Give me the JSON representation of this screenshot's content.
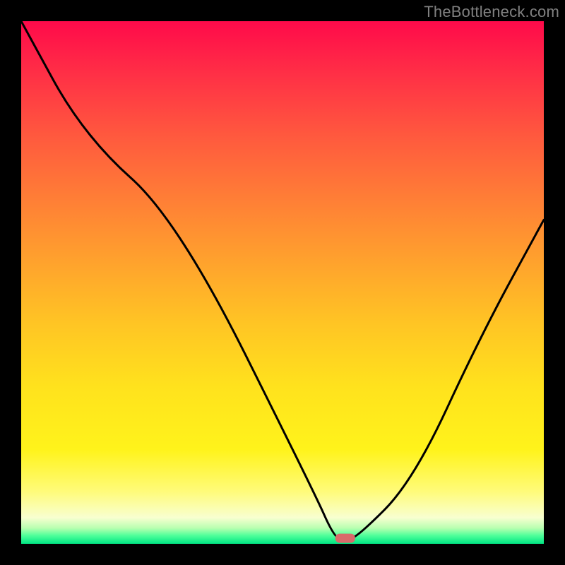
{
  "attribution": "TheBottleneck.com",
  "chart_data": {
    "type": "line",
    "title": "",
    "xlabel": "",
    "ylabel": "",
    "xlim": [
      0,
      100
    ],
    "ylim": [
      0,
      100
    ],
    "series": [
      {
        "name": "curve",
        "x": [
          0,
          12,
          30,
          56,
          60,
          62,
          64,
          75,
          88,
          100
        ],
        "values": [
          100,
          78,
          62,
          10,
          1,
          1,
          1,
          12,
          40,
          62
        ]
      }
    ],
    "marker": {
      "x": 62,
      "y": 1,
      "color": "#d96a6a"
    },
    "gradient_stops": [
      {
        "pos": 0,
        "color": "#ff0a4a"
      },
      {
        "pos": 0.46,
        "color": "#ffa22d"
      },
      {
        "pos": 0.82,
        "color": "#fff31b"
      },
      {
        "pos": 0.97,
        "color": "#b8ffb0"
      },
      {
        "pos": 1.0,
        "color": "#00e584"
      }
    ]
  }
}
